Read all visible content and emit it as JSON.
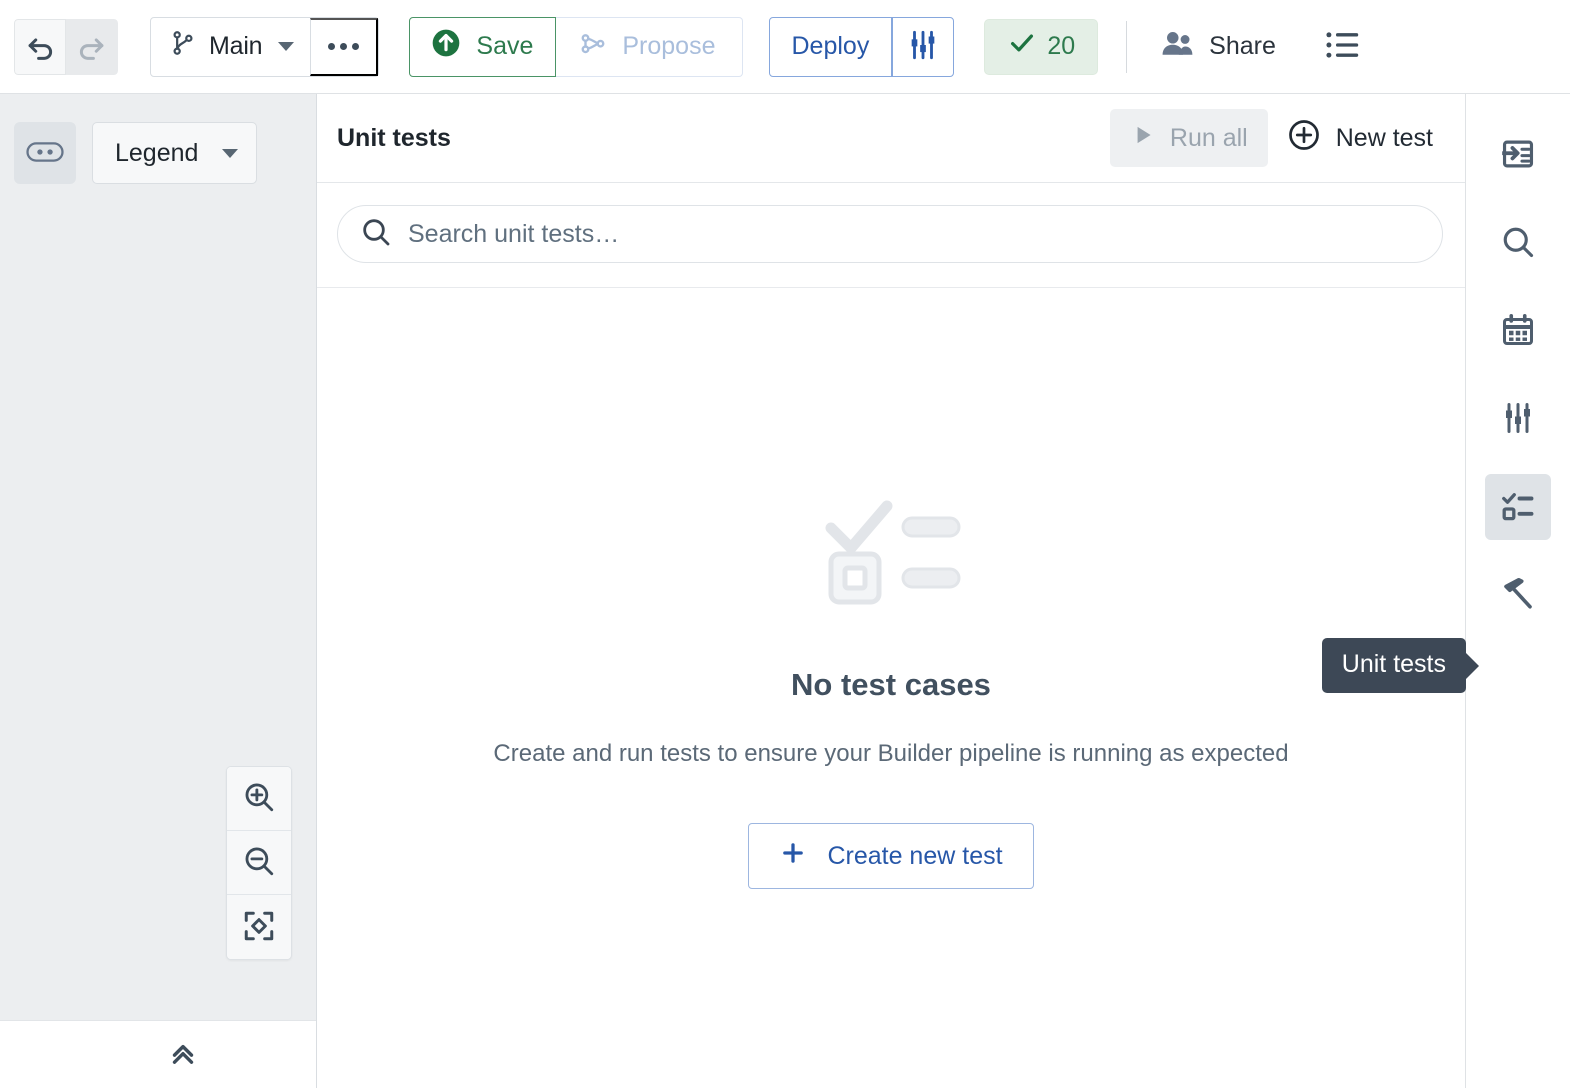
{
  "toolbar": {
    "undo_label": "Undo",
    "redo_label": "Redo",
    "branch_name": "Main",
    "more_label": "More options",
    "save_label": "Save",
    "propose_label": "Propose",
    "deploy_label": "Deploy",
    "deploy_settings_label": "Deploy settings",
    "checks_count": "20",
    "share_label": "Share",
    "list_label": "List view"
  },
  "graph_panel": {
    "pill_toggle_label": "Toggle node details",
    "legend_label": "Legend",
    "zoom_in_label": "Zoom in",
    "zoom_out_label": "Zoom out",
    "fit_label": "Fit to screen",
    "collapse_label": "Collapse panel"
  },
  "unit_tests": {
    "title": "Unit tests",
    "run_all_label": "Run all",
    "new_test_label": "New test",
    "search_placeholder": "Search unit tests…",
    "search_value": "",
    "empty_title": "No test cases",
    "empty_subtitle": "Create and run tests to ensure your Builder pipeline is running as expected",
    "create_label": "Create new test"
  },
  "right_rail": {
    "items": [
      {
        "name": "inputs",
        "label": "Inputs",
        "active": false
      },
      {
        "name": "search",
        "label": "Search",
        "active": false
      },
      {
        "name": "calendar",
        "label": "Schedules",
        "active": false
      },
      {
        "name": "parameters",
        "label": "Parameters",
        "active": false
      },
      {
        "name": "unit-tests",
        "label": "Unit tests",
        "active": true
      },
      {
        "name": "build",
        "label": "Build",
        "active": false
      }
    ],
    "tooltip": "Unit tests"
  },
  "colors": {
    "accent_blue": "#2757a8",
    "success_green": "#2d7a4d",
    "panel_bg": "#eceef0",
    "text_primary": "#1f262d",
    "text_muted": "#5b6977",
    "tooltip_bg": "#3d4856"
  }
}
